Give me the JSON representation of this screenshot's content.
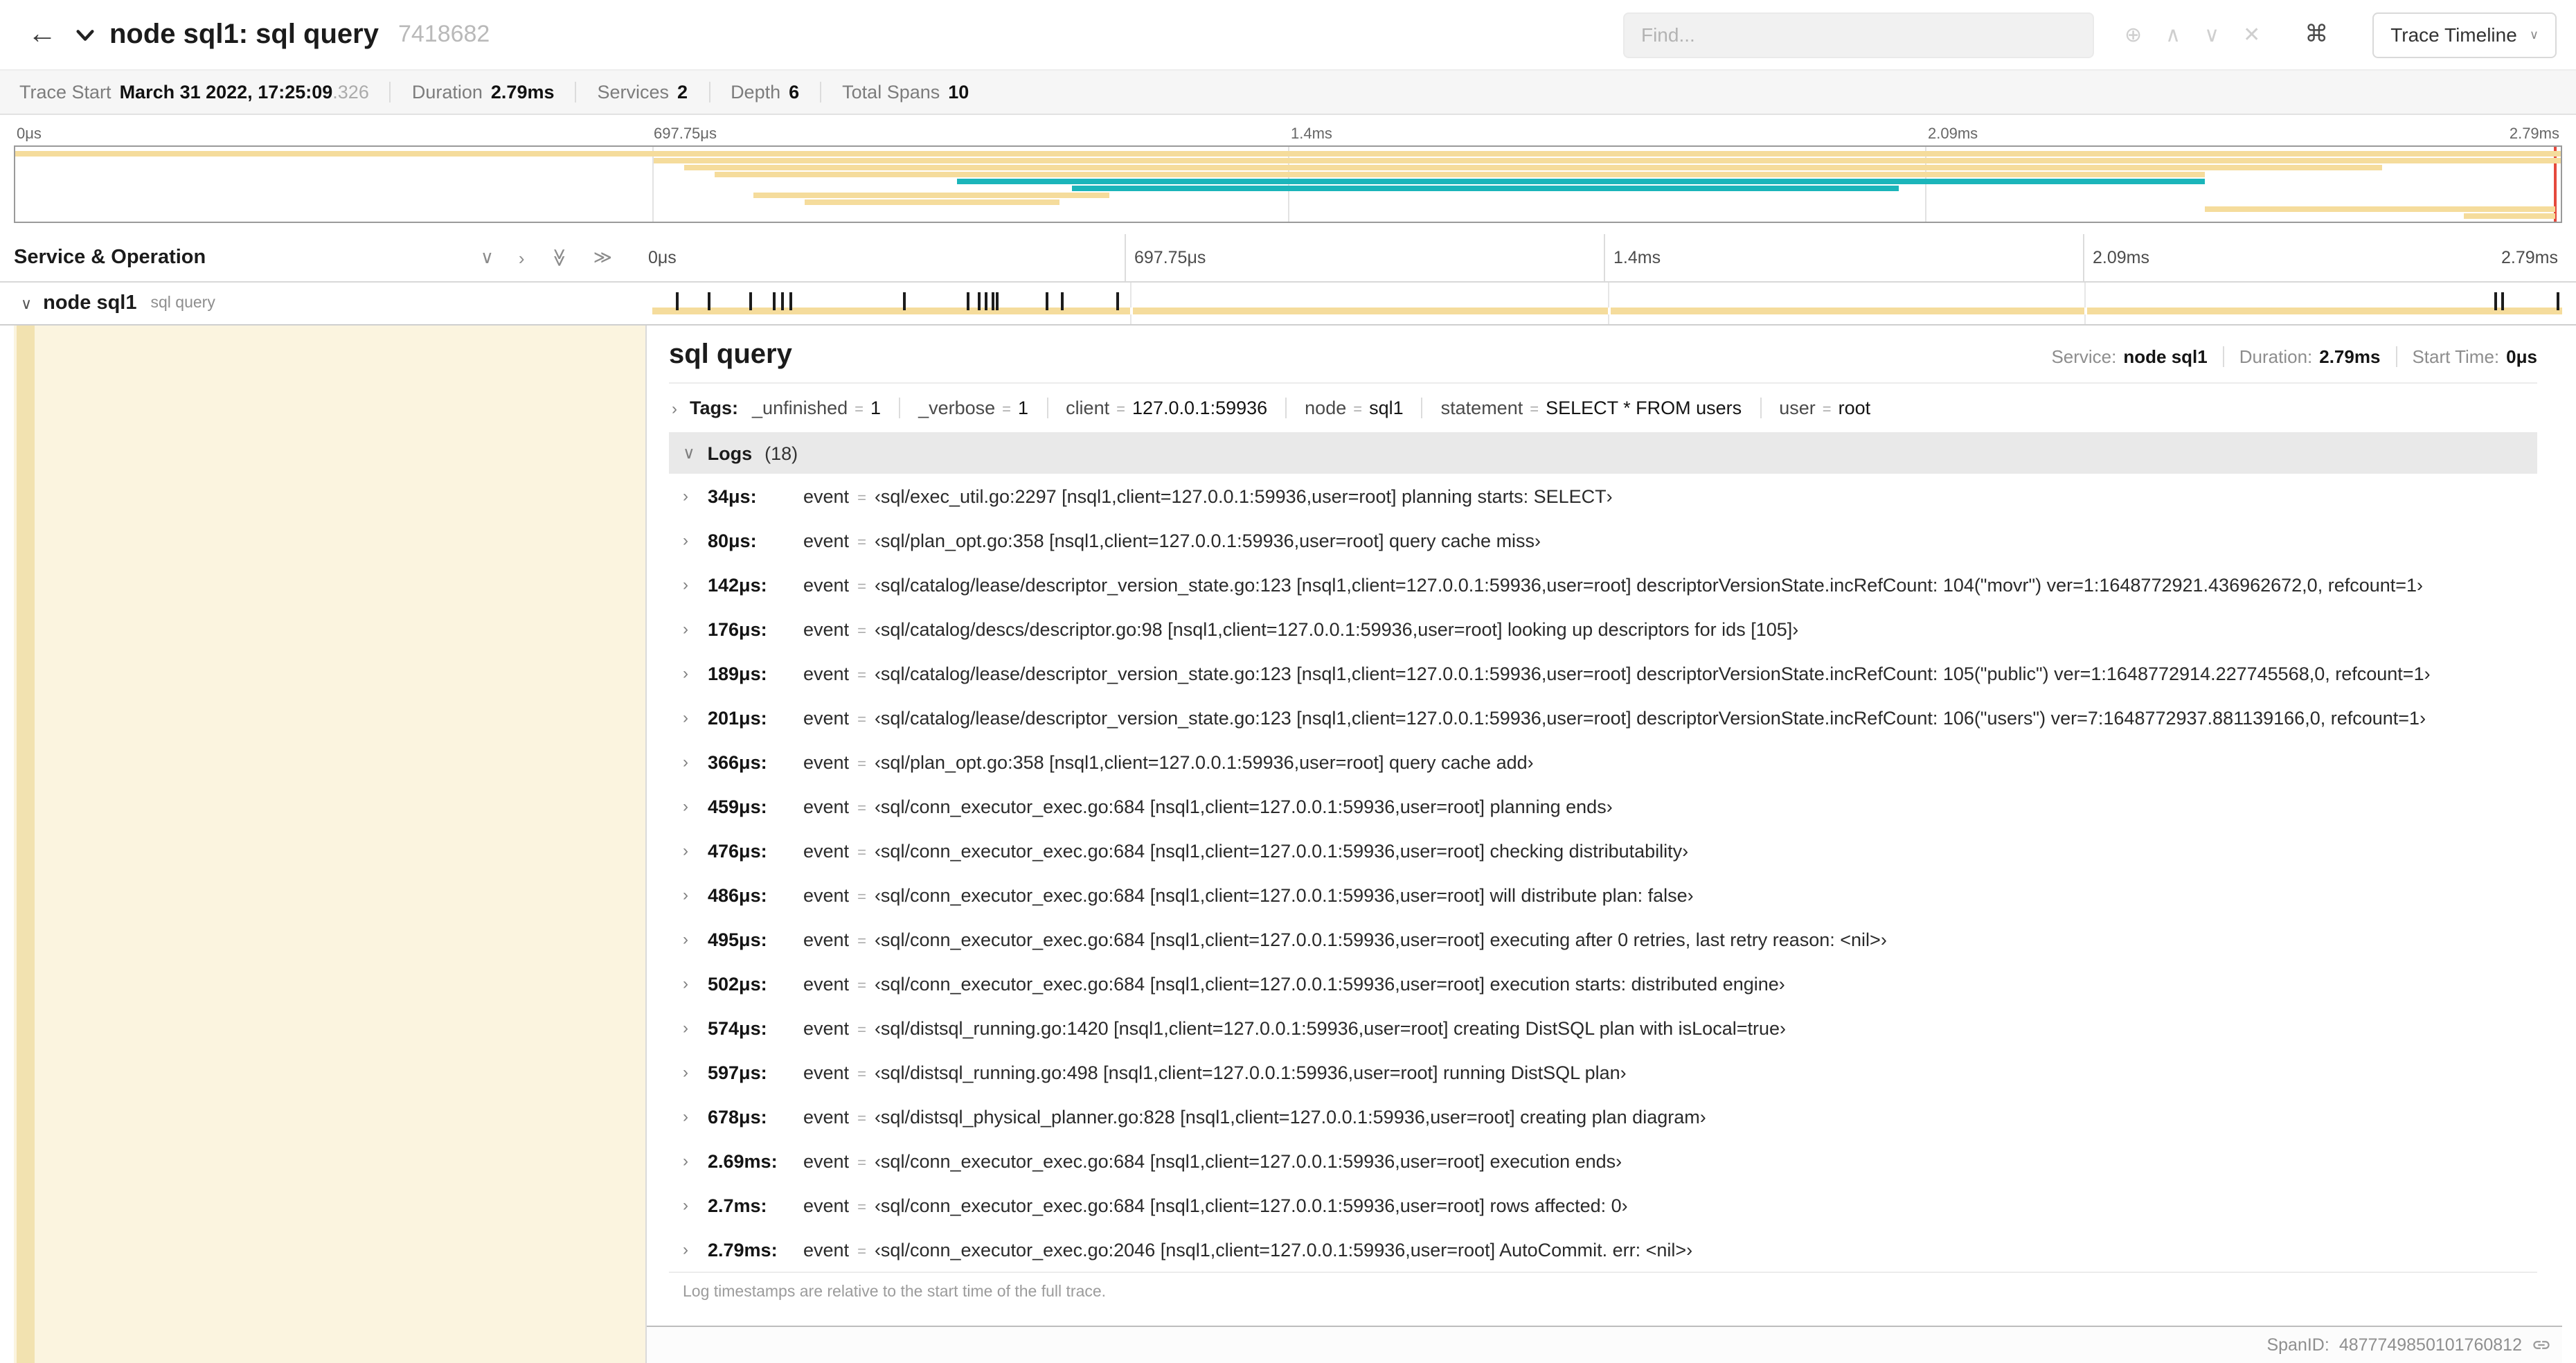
{
  "colors": {
    "tan": "#F5DC9C",
    "teal": "#1BB5BA",
    "red": "#E5493D",
    "cream": "#FBF4DF",
    "strip": "#F2E2B0",
    "tick": "#1C1C1C"
  },
  "icons": {
    "back": "←",
    "chevron_down": "∨",
    "chevron_right": "›",
    "double_chevron": "≫",
    "locate": "⊕",
    "prev": "∧",
    "next": "∨",
    "clear": "✕",
    "cmd": "⌘",
    "caret_down": "∨"
  },
  "misc": {
    "eq": "="
  },
  "header": {
    "title": "node sql1: sql query",
    "trace_id": "7418682",
    "find_placeholder": "Find...",
    "trace_timeline_label": "Trace Timeline"
  },
  "summary": {
    "items": [
      {
        "label": "Trace Start",
        "value": "March 31 2022, 17:25:09",
        "suffix": ".326"
      },
      {
        "label": "Duration",
        "value": "2.79ms",
        "suffix": ""
      },
      {
        "label": "Services",
        "value": "2",
        "suffix": ""
      },
      {
        "label": "Depth",
        "value": "6",
        "suffix": ""
      },
      {
        "label": "Total Spans",
        "value": "10",
        "suffix": ""
      }
    ]
  },
  "minimap": {
    "ticks": [
      "0μs",
      "697.75μs",
      "1.4ms",
      "2.09ms",
      "2.79ms"
    ],
    "bars": [
      {
        "s": 0,
        "w": 100,
        "c": "tan"
      },
      {
        "s": 25.1,
        "w": 74.9,
        "c": "tan"
      },
      {
        "s": 26.3,
        "w": 66.7,
        "c": "tan"
      },
      {
        "s": 27.5,
        "w": 58.5,
        "c": "tan"
      },
      {
        "s": 37.0,
        "w": 49.0,
        "c": "teal"
      },
      {
        "s": 41.5,
        "w": 32.5,
        "c": "teal"
      },
      {
        "s": 29.0,
        "w": 14.0,
        "c": "tan"
      },
      {
        "s": 31.0,
        "w": 10.0,
        "c": "tan"
      },
      {
        "s": 86.0,
        "w": 13.8,
        "c": "tan"
      },
      {
        "s": 96.2,
        "w": 3.6,
        "c": "tan"
      }
    ]
  },
  "timeline": {
    "left_header": "Service & Operation",
    "ticks": [
      "0μs",
      "697.75μs",
      "1.4ms",
      "2.09ms",
      "2.79ms"
    ],
    "duration_us": 2790,
    "row": {
      "service": "node sql1",
      "operation": "sql query"
    }
  },
  "detail": {
    "title": "sql query",
    "meta": {
      "service_label": "Service:",
      "service": "node sql1",
      "duration_label": "Duration:",
      "duration": "2.79ms",
      "start_label": "Start Time:",
      "start": "0μs"
    },
    "tags_label": "Tags:",
    "tags": [
      {
        "key": "_unfinished",
        "value": "1"
      },
      {
        "key": "_verbose",
        "value": "1"
      },
      {
        "key": "client",
        "value": "127.0.0.1:59936"
      },
      {
        "key": "node",
        "value": "sql1"
      },
      {
        "key": "statement",
        "value": "SELECT * FROM users"
      },
      {
        "key": "user",
        "value": "root"
      }
    ],
    "logs_label": "Logs",
    "logs_count": "(18)",
    "logs": [
      {
        "time": "34μs:",
        "t": 34,
        "key": "event",
        "value": "‹sql/exec_util.go:2297 [nsql1,client=127.0.0.1:59936,user=root] planning starts: SELECT›"
      },
      {
        "time": "80μs:",
        "t": 80,
        "key": "event",
        "value": "‹sql/plan_opt.go:358 [nsql1,client=127.0.0.1:59936,user=root] query cache miss›"
      },
      {
        "time": "142μs:",
        "t": 142,
        "key": "event",
        "value": "‹sql/catalog/lease/descriptor_version_state.go:123 [nsql1,client=127.0.0.1:59936,user=root] descriptorVersionState.incRefCount: 104(\"movr\") ver=1:1648772921.436962672,0, refcount=1›"
      },
      {
        "time": "176μs:",
        "t": 176,
        "key": "event",
        "value": "‹sql/catalog/descs/descriptor.go:98 [nsql1,client=127.0.0.1:59936,user=root] looking up descriptors for ids [105]›"
      },
      {
        "time": "189μs:",
        "t": 189,
        "key": "event",
        "value": "‹sql/catalog/lease/descriptor_version_state.go:123 [nsql1,client=127.0.0.1:59936,user=root] descriptorVersionState.incRefCount: 105(\"public\") ver=1:1648772914.227745568,0, refcount=1›"
      },
      {
        "time": "201μs:",
        "t": 201,
        "key": "event",
        "value": "‹sql/catalog/lease/descriptor_version_state.go:123 [nsql1,client=127.0.0.1:59936,user=root] descriptorVersionState.incRefCount: 106(\"users\") ver=7:1648772937.881139166,0, refcount=1›"
      },
      {
        "time": "366μs:",
        "t": 366,
        "key": "event",
        "value": "‹sql/plan_opt.go:358 [nsql1,client=127.0.0.1:59936,user=root] query cache add›"
      },
      {
        "time": "459μs:",
        "t": 459,
        "key": "event",
        "value": "‹sql/conn_executor_exec.go:684 [nsql1,client=127.0.0.1:59936,user=root] planning ends›"
      },
      {
        "time": "476μs:",
        "t": 476,
        "key": "event",
        "value": "‹sql/conn_executor_exec.go:684 [nsql1,client=127.0.0.1:59936,user=root] checking distributability›"
      },
      {
        "time": "486μs:",
        "t": 486,
        "key": "event",
        "value": "‹sql/conn_executor_exec.go:684 [nsql1,client=127.0.0.1:59936,user=root] will distribute plan: false›"
      },
      {
        "time": "495μs:",
        "t": 495,
        "key": "event",
        "value": "‹sql/conn_executor_exec.go:684 [nsql1,client=127.0.0.1:59936,user=root] executing after 0 retries, last retry reason: <nil>›"
      },
      {
        "time": "502μs:",
        "t": 502,
        "key": "event",
        "value": "‹sql/conn_executor_exec.go:684 [nsql1,client=127.0.0.1:59936,user=root] execution starts: distributed engine›"
      },
      {
        "time": "574μs:",
        "t": 574,
        "key": "event",
        "value": "‹sql/distsql_running.go:1420 [nsql1,client=127.0.0.1:59936,user=root] creating DistSQL plan with isLocal=true›"
      },
      {
        "time": "597μs:",
        "t": 597,
        "key": "event",
        "value": "‹sql/distsql_running.go:498 [nsql1,client=127.0.0.1:59936,user=root] running DistSQL plan›"
      },
      {
        "time": "678μs:",
        "t": 678,
        "key": "event",
        "value": "‹sql/distsql_physical_planner.go:828 [nsql1,client=127.0.0.1:59936,user=root] creating plan diagram›"
      },
      {
        "time": "2.69ms:",
        "t": 2690,
        "key": "event",
        "value": "‹sql/conn_executor_exec.go:684 [nsql1,client=127.0.0.1:59936,user=root] execution ends›"
      },
      {
        "time": "2.7ms:",
        "t": 2700,
        "key": "event",
        "value": "‹sql/conn_executor_exec.go:684 [nsql1,client=127.0.0.1:59936,user=root] rows affected: 0›"
      },
      {
        "time": "2.79ms:",
        "t": 2790,
        "key": "event",
        "value": "‹sql/conn_executor_exec.go:2046 [nsql1,client=127.0.0.1:59936,user=root] AutoCommit. err: <nil>›"
      }
    ],
    "logs_footer": "Log timestamps are relative to the start time of the full trace.",
    "spanid_label": "SpanID:",
    "spanid": "4877749850101760812"
  }
}
